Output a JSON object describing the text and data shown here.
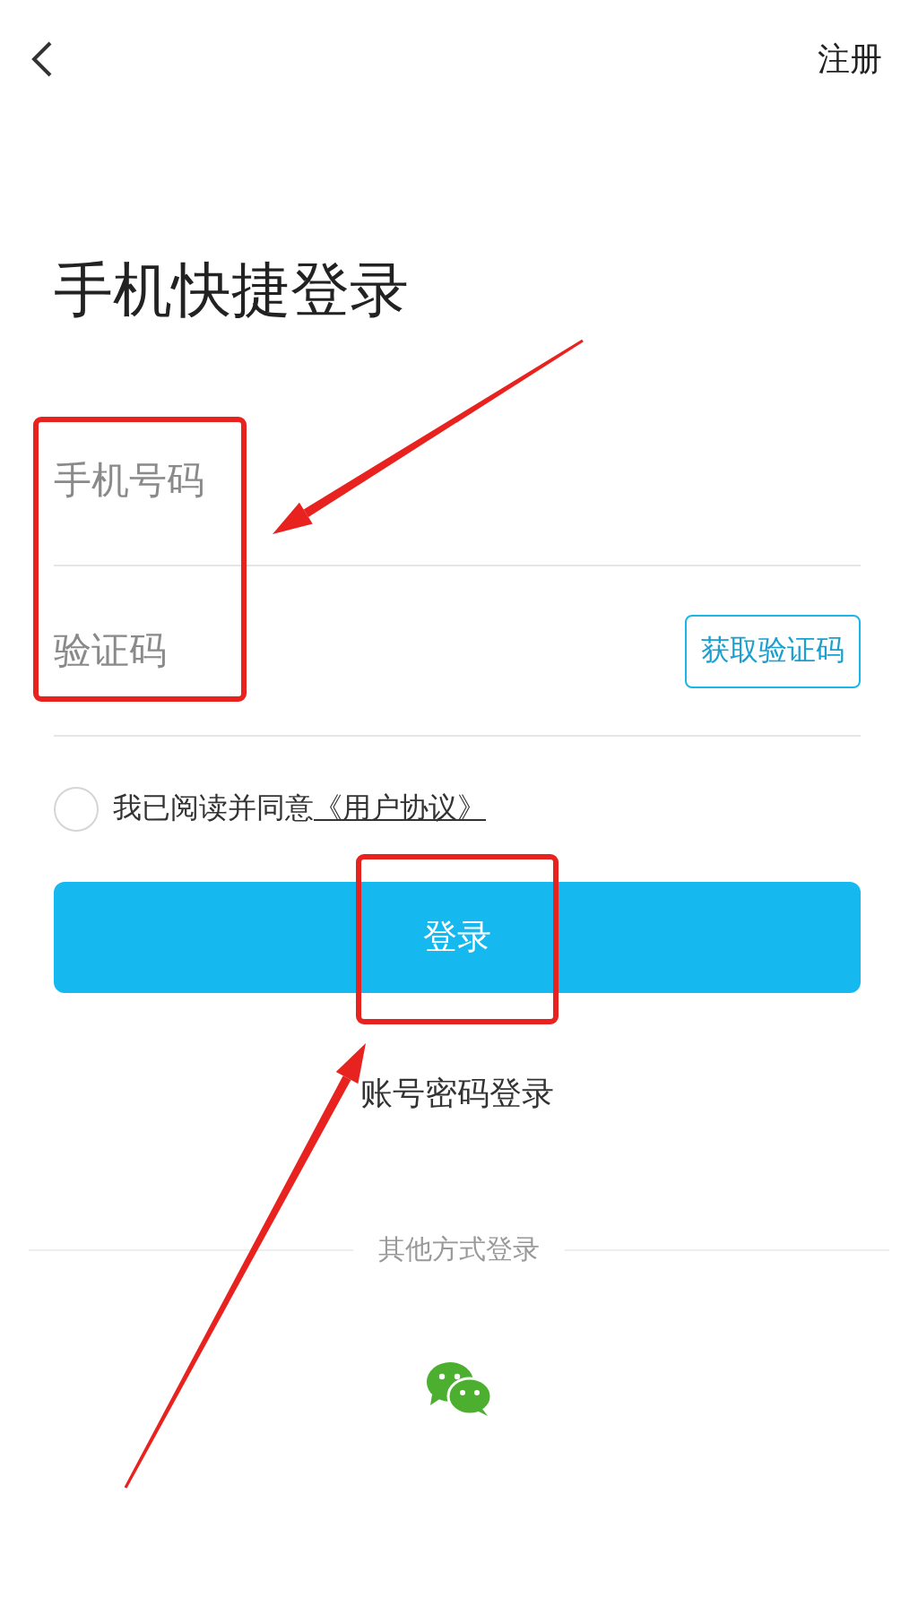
{
  "header": {
    "register_link": "注册"
  },
  "title": "手机快捷登录",
  "form": {
    "phone": {
      "placeholder": "手机号码"
    },
    "code": {
      "placeholder": "验证码"
    },
    "get_code_button": "获取验证码"
  },
  "agreement": {
    "checked": false,
    "text": "我已阅读并同意",
    "link": "《用户协议》"
  },
  "login_button": "登录",
  "password_login_link": "账号密码登录",
  "other_methods": {
    "label": "其他方式登录"
  },
  "annotations": [
    {
      "kind": "box"
    },
    {
      "kind": "box"
    },
    {
      "kind": "arrow"
    },
    {
      "kind": "arrow"
    }
  ]
}
